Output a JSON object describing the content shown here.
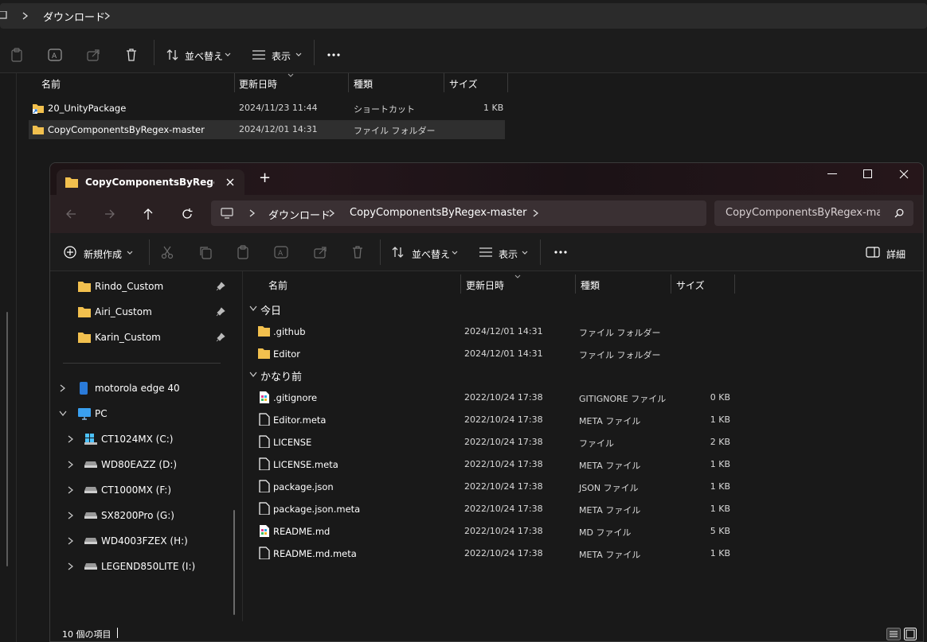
{
  "background_window": {
    "breadcrumb": [
      "ダウンロード"
    ],
    "toolbar": {
      "sort_label": "並べ替え",
      "view_label": "表示",
      "more_label": "…"
    },
    "columns": [
      "名前",
      "更新日時",
      "種類",
      "サイズ"
    ],
    "files": [
      {
        "name": "20_UnityPackage",
        "date": "2024/11/23 11:44",
        "type": "ショートカット",
        "size": "1 KB"
      },
      {
        "name": "CopyComponentsByRegex-master",
        "date": "2024/12/01 14:31",
        "type": "ファイル フォルダー",
        "size": ""
      }
    ]
  },
  "window": {
    "tab_title": "CopyComponentsByRegex-master",
    "add_tab": "+",
    "breadcrumb": [
      "ダウンロード",
      "CopyComponentsByRegex-master"
    ],
    "search_placeholder": "CopyComponentsByRegex-master",
    "toolbar": {
      "new_label": "新規作成",
      "sort_label": "並べ替え",
      "view_label": "表示",
      "details_label": "詳細"
    },
    "nav_pinned": [
      "Rindo_Custom",
      "Airi_Custom",
      "Karin_Custom"
    ],
    "nav_devices": [
      {
        "label": "motorola edge 40",
        "icon": "phone-icon"
      },
      {
        "label": "PC",
        "icon": "monitor-icon"
      },
      {
        "label": "CT1024MX (C:)",
        "icon": "windows-drive-icon"
      },
      {
        "label": "WD80EAZZ (D:)",
        "icon": "drive-icon"
      },
      {
        "label": "CT1000MX (F:)",
        "icon": "drive-icon"
      },
      {
        "label": "SX8200Pro (G:)",
        "icon": "drive-icon"
      },
      {
        "label": "WD4003FZEX (H:)",
        "icon": "drive-icon"
      },
      {
        "label": "LEGEND850LITE (I:)",
        "icon": "drive-icon"
      }
    ],
    "columns": [
      "名前",
      "更新日時",
      "種類",
      "サイズ"
    ],
    "groups": [
      {
        "label": "今日",
        "items": [
          {
            "name": ".github",
            "date": "2024/12/01 14:31",
            "type": "ファイル フォルダー",
            "size": "",
            "icon": "folder-icon"
          },
          {
            "name": "Editor",
            "date": "2024/12/01 14:31",
            "type": "ファイル フォルダー",
            "size": "",
            "icon": "folder-icon"
          }
        ]
      },
      {
        "label": "かなり前",
        "items": [
          {
            "name": ".gitignore",
            "date": "2022/10/24 17:38",
            "type": "GITIGNORE ファイル",
            "size": "0 KB",
            "icon": "color-file-icon"
          },
          {
            "name": "Editor.meta",
            "date": "2022/10/24 17:38",
            "type": "META ファイル",
            "size": "1 KB",
            "icon": "file-icon"
          },
          {
            "name": "LICENSE",
            "date": "2022/10/24 17:38",
            "type": "ファイル",
            "size": "2 KB",
            "icon": "file-icon"
          },
          {
            "name": "LICENSE.meta",
            "date": "2022/10/24 17:38",
            "type": "META ファイル",
            "size": "1 KB",
            "icon": "file-icon"
          },
          {
            "name": "package.json",
            "date": "2022/10/24 17:38",
            "type": "JSON ファイル",
            "size": "1 KB",
            "icon": "file-icon"
          },
          {
            "name": "package.json.meta",
            "date": "2022/10/24 17:38",
            "type": "META ファイル",
            "size": "1 KB",
            "icon": "file-icon"
          },
          {
            "name": "README.md",
            "date": "2022/10/24 17:38",
            "type": "MD ファイル",
            "size": "5 KB",
            "icon": "color-file-icon"
          },
          {
            "name": "README.md.meta",
            "date": "2022/10/24 17:38",
            "type": "META ファイル",
            "size": "1 KB",
            "icon": "file-icon"
          }
        ]
      }
    ],
    "status": "10 個の項目"
  },
  "colors": {
    "folder": "#f2c04e",
    "accent": "#4cc2ff",
    "selected_row": "#2f2f2f"
  }
}
